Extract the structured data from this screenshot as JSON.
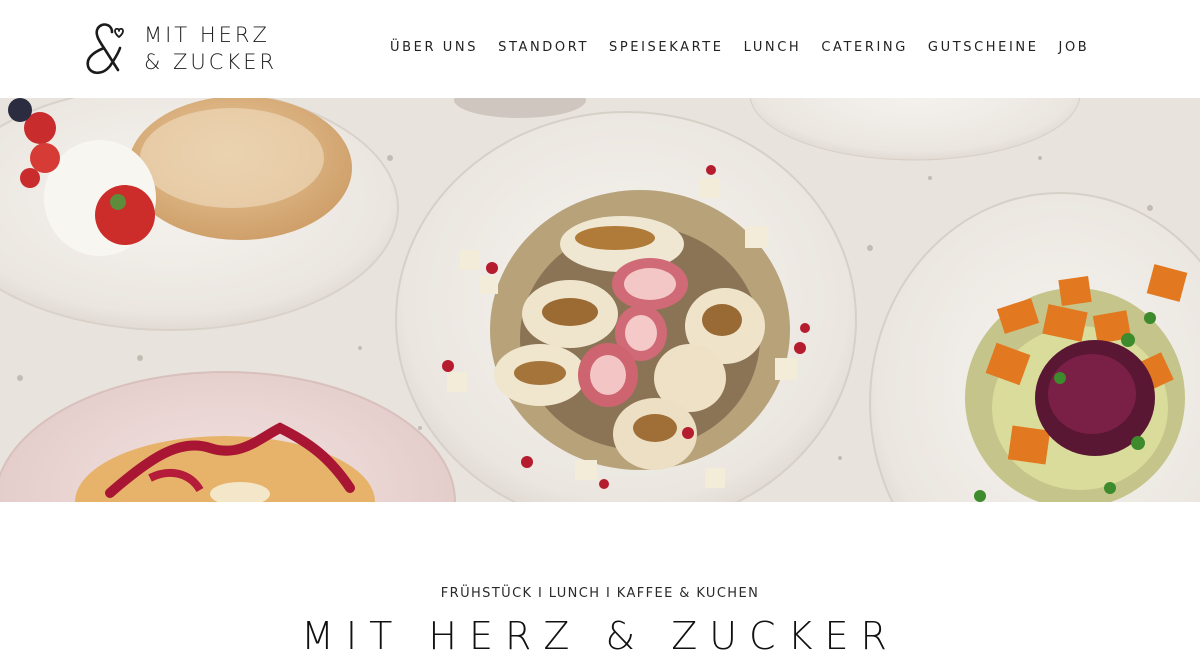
{
  "brand": {
    "line1": "MIT HERZ",
    "line2": "& ZUCKER",
    "logo_icon": "ampersand-heart-logo"
  },
  "nav": {
    "items": [
      {
        "label": "ÜBER UNS"
      },
      {
        "label": "STANDORT"
      },
      {
        "label": "SPEISEKARTE"
      },
      {
        "label": "LUNCH"
      },
      {
        "label": "CATERING"
      },
      {
        "label": "GUTSCHEINE"
      },
      {
        "label": "JOB"
      }
    ]
  },
  "hero": {
    "image_subject": "food-bowls-photo",
    "background_color": "#e9e4dd"
  },
  "intro": {
    "kicker": "FRÜHSTÜCK I LUNCH I KAFFEE & KUCHEN",
    "headline": "MIT HERZ & ZUCKER"
  }
}
